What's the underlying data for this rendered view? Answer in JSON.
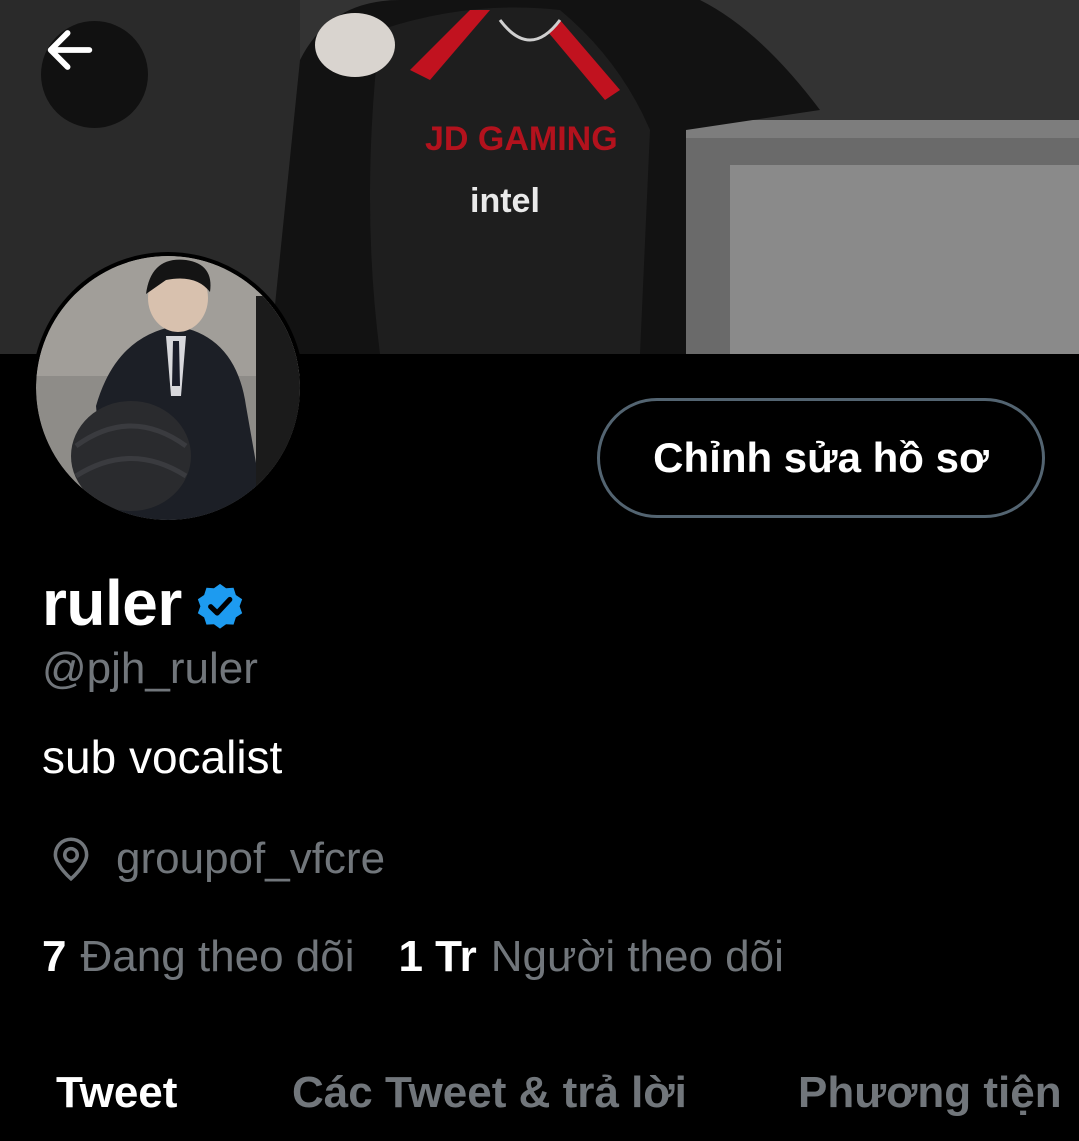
{
  "header": {
    "back_icon": "arrow-left-icon"
  },
  "banner": {
    "jersey_brand": "JD GAMING",
    "jersey_sponsor": "intel"
  },
  "profile": {
    "edit_button_label": "Chỉnh sửa hồ sơ",
    "display_name": "ruler",
    "verified_icon": "verified-badge-icon",
    "handle": "@pjh_ruler",
    "bio": "sub vocalist",
    "location_icon": "location-pin-icon",
    "location": "groupof_vfcre",
    "following_count": "7",
    "following_label": "Đang theo dõi",
    "followers_count": "1 Tr",
    "followers_label": "Người theo dõi"
  },
  "tabs": [
    {
      "label": "Tweet",
      "active": true
    },
    {
      "label": "Các Tweet & trả lời",
      "active": false
    },
    {
      "label": "Phương tiện",
      "active": false
    }
  ],
  "colors": {
    "background": "#000000",
    "primary_text": "#ffffff",
    "secondary_text": "#71767b",
    "verified_blue": "#1d9bf0",
    "button_border": "#536471"
  }
}
